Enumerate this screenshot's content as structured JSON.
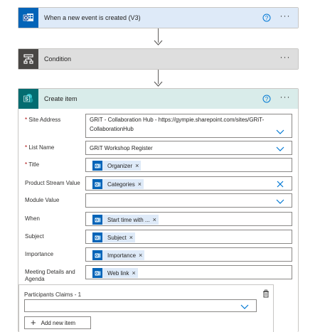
{
  "steps": [
    {
      "title": "When a new event is created (V3)",
      "icon": "outlook-icon",
      "header_color": "#deeaf8",
      "icon_bg": "#0364b8"
    },
    {
      "title": "Condition",
      "icon": "condition-icon",
      "header_color": "#dedede",
      "icon_bg": "#484644"
    },
    {
      "title": "Create item",
      "icon": "sharepoint-icon",
      "header_color": "#d9ecea",
      "icon_bg": "#036c70"
    }
  ],
  "more_label": "···",
  "form": {
    "site_address": {
      "label": "Site Address",
      "value_line1": "GRiT - Collaboration Hub - https://gympie.sharepoint.com/sites/GRiT-",
      "value_line2": "CollaborationHub"
    },
    "list_name": {
      "label": "List Name",
      "value": "GRiT Workshop Register"
    },
    "title": {
      "label": "Title",
      "token": "Organizer"
    },
    "product_stream": {
      "label": "Product Stream Value",
      "token": "Categories"
    },
    "module_value": {
      "label": "Module Value",
      "value": ""
    },
    "when": {
      "label": "When",
      "token": "Start time with ..."
    },
    "subject": {
      "label": "Subject",
      "token": "Subject"
    },
    "importance": {
      "label": "Importance",
      "token": "Importance"
    },
    "meeting_details": {
      "label_line1": "Meeting Details and",
      "label_line2": "Agenda",
      "token": "Web link"
    },
    "participants": {
      "label": "Participants Claims - 1",
      "value": "",
      "add_label": "Add new item"
    }
  },
  "required_mark": "*",
  "token_remove": "×"
}
